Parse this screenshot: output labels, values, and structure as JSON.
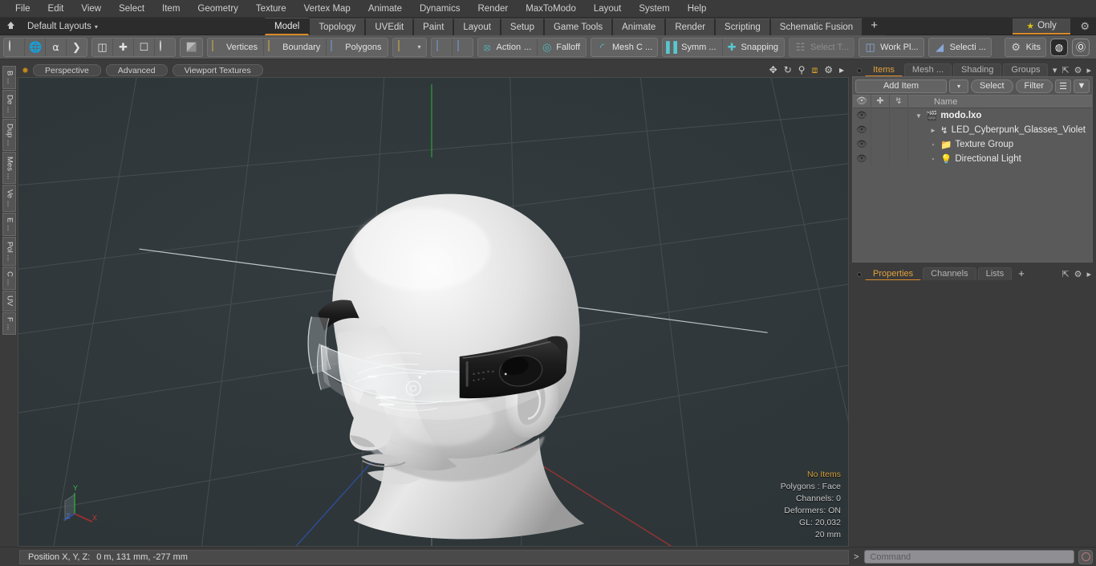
{
  "menubar": {
    "items": [
      "File",
      "Edit",
      "View",
      "Select",
      "Item",
      "Geometry",
      "Texture",
      "Vertex Map",
      "Animate",
      "Dynamics",
      "Render",
      "MaxToModo",
      "Layout",
      "System",
      "Help"
    ]
  },
  "layoutbar": {
    "home_icon": "home-icon",
    "layouts_label": "Default Layouts",
    "caret": "▾",
    "tabs": [
      {
        "label": "Model",
        "active": true
      },
      {
        "label": "Topology",
        "active": false
      },
      {
        "label": "UVEdit",
        "active": false
      },
      {
        "label": "Paint",
        "active": false
      },
      {
        "label": "Layout",
        "active": false
      },
      {
        "label": "Setup",
        "active": false
      },
      {
        "label": "Game Tools",
        "active": false
      },
      {
        "label": "Animate",
        "active": false
      },
      {
        "label": "Render",
        "active": false
      },
      {
        "label": "Scripting",
        "active": false
      },
      {
        "label": "Schematic Fusion",
        "active": false
      }
    ],
    "add_tab_label": "+",
    "only_label": "Only",
    "only_icon": "star-icon",
    "settings_icon": "gear-icon"
  },
  "toolbar": {
    "shape_tools": [
      "circle-icon",
      "globe-icon",
      "pen-icon",
      "curve-icon"
    ],
    "arrange_tools": [
      "mirror-icon",
      "center-icon",
      "frame-icon",
      "ellipse-icon"
    ],
    "mesh_mode_icon": "mesh-cube-icon",
    "selection_modes": [
      {
        "label": "Vertices",
        "icon": "vertices-icon"
      },
      {
        "label": "Boundary",
        "icon": "boundary-icon"
      },
      {
        "label": "Polygons",
        "icon": "polygons-icon"
      }
    ],
    "item_mode_icon": "item-cube-icon",
    "item_mode_caret": "▾",
    "paint_icons": [
      "paint-select-icon",
      "paint-select-alt-icon"
    ],
    "action_center": {
      "label": "Action",
      "ellipsis": "...",
      "icon": "action-center-icon"
    },
    "falloff": {
      "label": "Falloff",
      "icon": "falloff-icon"
    },
    "mesh_constraint": {
      "label": "Mesh C ...",
      "icon": "mesh-constraint-icon"
    },
    "symmetry": {
      "label": "Symm ...",
      "icon": "symmetry-icon"
    },
    "snapping": {
      "label": "Snapping",
      "icon": "snapping-icon"
    },
    "select_through": {
      "label": "Select T...",
      "icon": "select-through-icon",
      "disabled": true
    },
    "work_plane": {
      "label": "Work Pl...",
      "icon": "work-plane-icon"
    },
    "selection_sets": {
      "label": "Selecti ...",
      "icon": "selection-set-icon"
    },
    "kits": {
      "label": "Kits",
      "icon": "kits-gear-icon"
    },
    "right_icons": [
      "modo-sphere-icon",
      "unreal-engine-icon"
    ]
  },
  "vertical_tabs": [
    "B ...",
    "De ...",
    "Dup ...",
    "Mes ...",
    "Ve ...",
    "E ...",
    "Pol ...",
    "C ...",
    "UV",
    "F ..."
  ],
  "viewport": {
    "dot_icon": "record-dot-icon",
    "buttons": [
      "Perspective",
      "Advanced",
      "Viewport Textures"
    ],
    "control_icons": [
      "pan-icon",
      "rotate-icon",
      "zoom-icon",
      "fit-icon",
      "gear-icon",
      "more-arrow-icon"
    ],
    "info": {
      "selection": "No Items",
      "polygons": "Polygons : Face",
      "channels": "Channels: 0",
      "deformers": "Deformers: ON",
      "gl": "GL: 20,032",
      "grid": "20 mm"
    },
    "axis_labels": {
      "x": "X",
      "y": "Y",
      "z": "Z"
    },
    "colors": {
      "background": "#2f373a",
      "grid": "#495154",
      "axis_x": "#b03a3a",
      "axis_y": "#3f9c3f",
      "axis_z": "#3a5fb0",
      "model": "#d8d8d8"
    }
  },
  "right_panel": {
    "tabs": [
      {
        "label": "Items",
        "active": true
      },
      {
        "label": "Mesh ...",
        "active": false
      },
      {
        "label": "Shading",
        "active": false
      },
      {
        "label": "Groups",
        "active": false
      }
    ],
    "tab_add": "+",
    "tab_caret": "▾",
    "tab_icons": [
      "expand-icon",
      "gear-icon",
      "more-arrow-icon"
    ],
    "items_toolbar": {
      "add_item": "Add Item",
      "add_item_caret": "▾",
      "select": "Select",
      "filter": "Filter",
      "list_icon": "list-options-icon",
      "funnel_icon": "funnel-icon"
    },
    "tree_headers": {
      "visibility": "eye-icon",
      "lock": "move-icon",
      "axis": "axis-icon",
      "name": "Name"
    },
    "tree_rows": [
      {
        "label": "modo.lxo",
        "icon": "scene-icon",
        "depth": 0,
        "root": true,
        "twist": "▼",
        "eye": "eye-icon"
      },
      {
        "label": "LED_Cyberpunk_Glasses_Violet",
        "icon": "mesh-axis-icon",
        "depth": 1,
        "root": false,
        "twist": "►",
        "eye": "eye-icon"
      },
      {
        "label": "Texture Group",
        "icon": "folder-icon",
        "depth": 1,
        "root": false,
        "twist": "",
        "eye": "eye-icon"
      },
      {
        "label": "Directional Light",
        "icon": "light-icon",
        "depth": 1,
        "root": false,
        "twist": "",
        "eye": "eye-icon"
      }
    ],
    "bottom_tabs": [
      {
        "label": "Properties",
        "active": true
      },
      {
        "label": "Channels",
        "active": false
      },
      {
        "label": "Lists",
        "active": false
      }
    ],
    "bottom_tab_add": "+",
    "bottom_tab_icons": [
      "expand-icon",
      "gear-icon",
      "more-arrow-icon"
    ]
  },
  "statusbar": {
    "position_label": "Position X, Y, Z:",
    "position_value": "0 m, 131 mm, -277 mm",
    "command_chevron": ">",
    "command_placeholder": "Command",
    "command_button_icon": "record-circle-icon"
  }
}
